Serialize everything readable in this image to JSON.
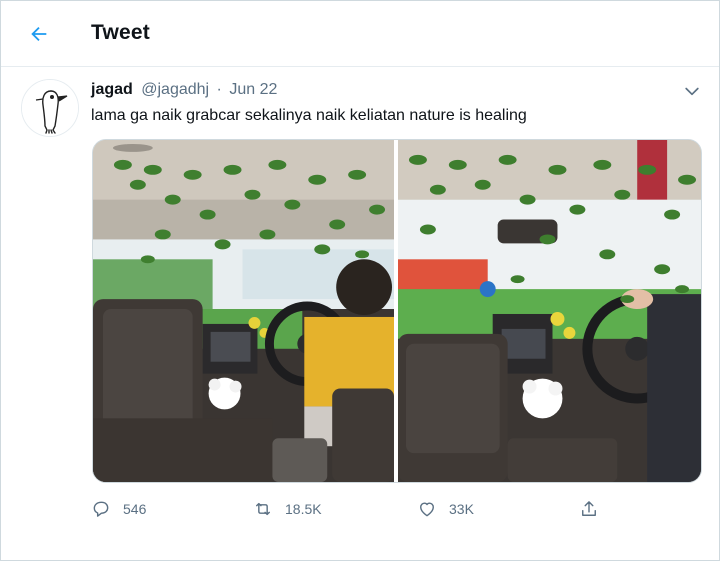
{
  "header": {
    "title": "Tweet",
    "back_icon": "arrow-left-icon"
  },
  "tweet": {
    "author_name": "jagad",
    "author_handle": "@jagadhj",
    "separator": "·",
    "date": "Jun 22",
    "text": "lama ga naik grabcar sekalinya naik keliatan nature is healing",
    "more_icon": "chevron-down-icon",
    "avatar_icon": "bird-doodle-icon"
  },
  "actions": {
    "reply_count": "546",
    "retweet_count": "18.5K",
    "like_count": "33K",
    "reply_icon": "reply-icon",
    "retweet_icon": "retweet-icon",
    "like_icon": "heart-icon",
    "share_icon": "share-icon"
  },
  "colors": {
    "accent": "#1d9bf0",
    "muted_text": "#5b7083",
    "border": "#cfd9de"
  }
}
